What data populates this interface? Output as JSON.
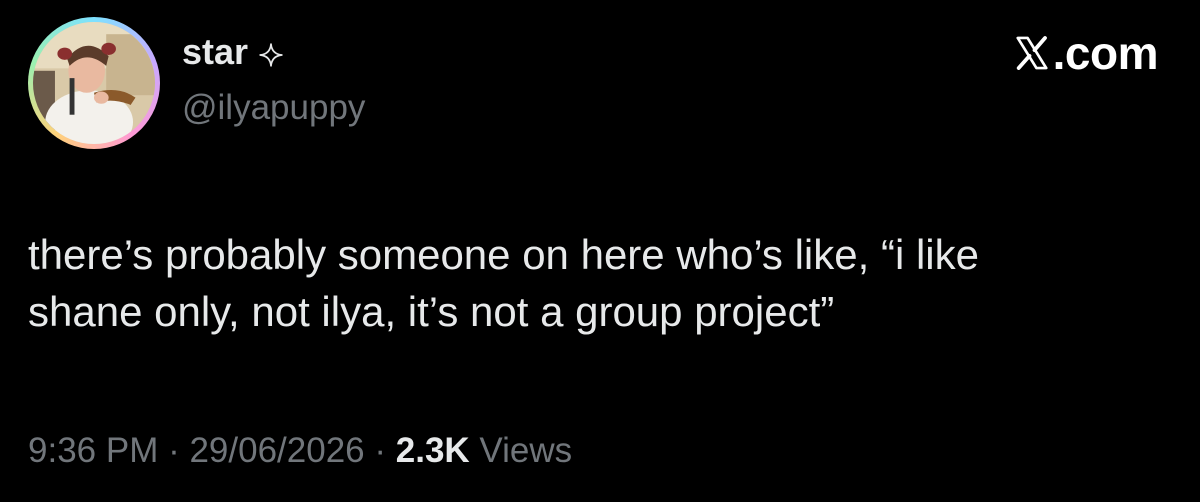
{
  "author": {
    "display_name": "star",
    "handle": "@ilyapuppy",
    "badge_icon": "sparkle-icon",
    "avatar_ring_colors": [
      "#7de1ff",
      "#c9a8ff",
      "#ff9ad5",
      "#ffd27a",
      "#9bf0b0"
    ]
  },
  "brand": {
    "icon": "x-logo-icon",
    "suffix": ".com"
  },
  "tweet": {
    "text": "there’s probably someone on here who’s like, “i like\nshane only, not ilya, it’s not a group project”"
  },
  "meta": {
    "time": "9:36 PM",
    "separator_1": " · ",
    "date": "29/06/2026",
    "separator_2": " · ",
    "views_count": "2.3K",
    "views_label": " Views"
  },
  "colors": {
    "background": "#000000",
    "primary_text": "#e7e9ea",
    "secondary_text": "#71767b"
  }
}
